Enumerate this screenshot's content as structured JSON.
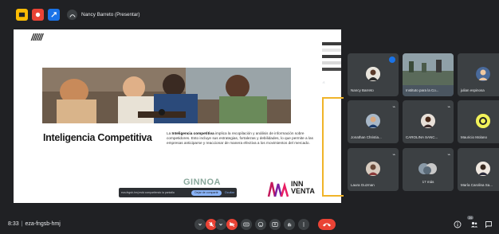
{
  "window": {
    "background": "#202124"
  },
  "topbar": {
    "icons": [
      "present-icon",
      "record-icon",
      "tools-icon"
    ],
    "colors": [
      "#fbbc04",
      "#ea4335",
      "#1a73e8"
    ],
    "presenter_label": "Nancy Barreto (Presentar)"
  },
  "slide": {
    "slashes": "//////",
    "heading": "Inteligencia Competitiva",
    "body_bold": "Inteligencia competitiva",
    "body_prefix": "La ",
    "body_rest": " implica la recopilación y análisis de información sobre competidores. Esto incluye sus estrategias, fortalezas y debilidades, lo que permite a las empresas anticiparse y reaccionar de manera efectiva a los movimientos del mercado.",
    "logo_left": "GINNOA",
    "logo_right_line1": "INN",
    "logo_right_line2": "VENTA",
    "accent_color": "#f0b429"
  },
  "share_banner": {
    "text": "eza-fngsb-hmj está compartiendo la pantalla",
    "stop_label": "Dejar de compartir",
    "ok_label": "Ocultar"
  },
  "participants": [
    {
      "name": "Nancy Barreto",
      "speaking": true
    },
    {
      "name": "Instituto para la Co..."
    },
    {
      "name": "julian espinosa"
    },
    {
      "name": "Jonathan Christia..."
    },
    {
      "name": "CAROLINA SANC..."
    },
    {
      "name": "Mauricio Molano"
    },
    {
      "name": "Laura Guzman"
    },
    {
      "name": "17 más"
    },
    {
      "name": "María Carolina Sa..."
    }
  ],
  "bottombar": {
    "time": "8:33",
    "meeting_code": "eza-fngsb-hmj",
    "participants_count": "26",
    "controls": [
      "mic-icon",
      "camera-icon",
      "captions-icon",
      "emoji-icon",
      "present-screen-icon",
      "raise-hand-icon",
      "more-icon",
      "hangup-icon"
    ]
  }
}
